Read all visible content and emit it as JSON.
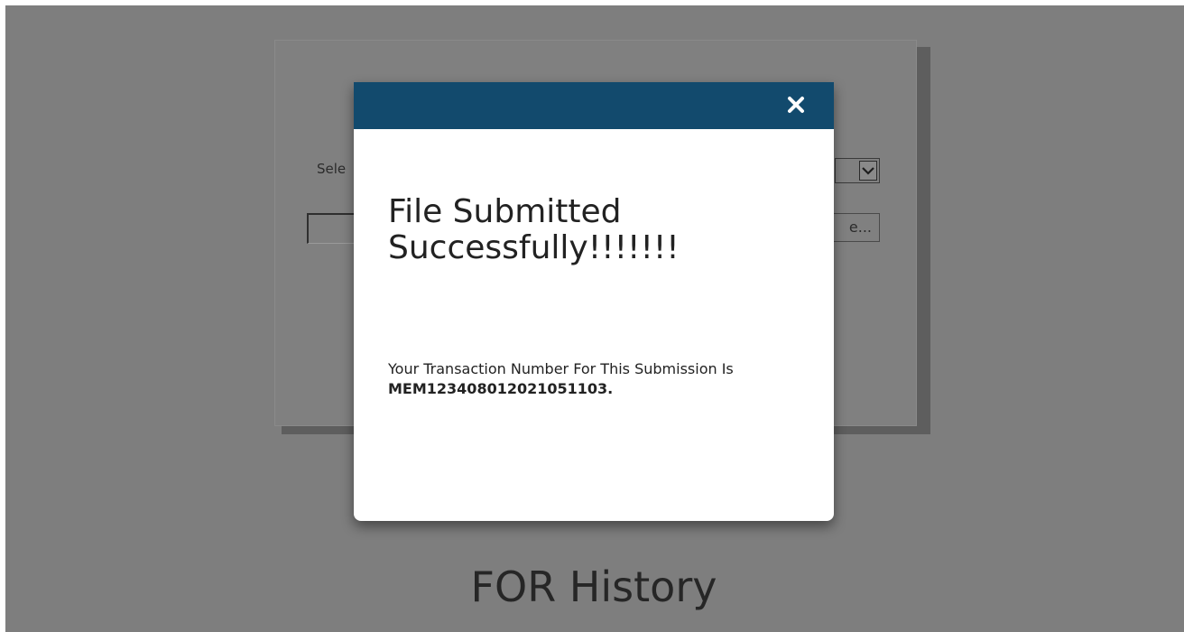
{
  "background_form": {
    "select_label_partial": "Sele",
    "browse_button_partial": "e..."
  },
  "history": {
    "heading": "FOR History"
  },
  "modal": {
    "close_label": "×",
    "title": "File Submitted Successfully!!!!!!!",
    "message": "Your Transaction Number For This Submission Is",
    "transaction_number": "MEM123408012021051103.",
    "header_color": "#124a6d"
  },
  "icons": {
    "close": "close-icon",
    "dropdown": "chevron-down-icon"
  }
}
